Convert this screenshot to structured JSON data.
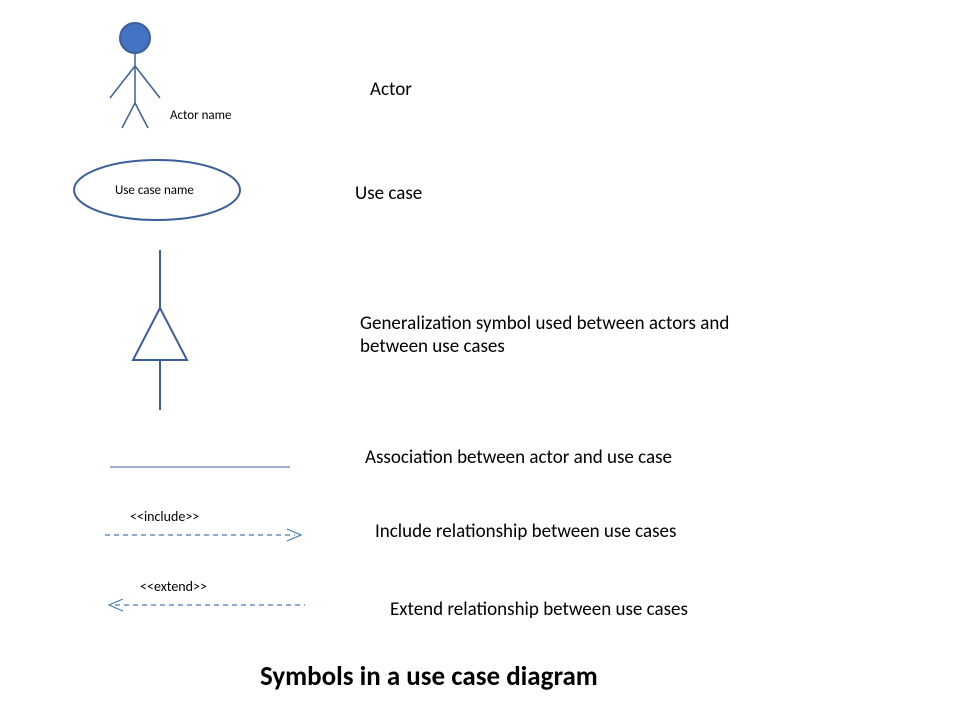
{
  "colors": {
    "shape_stroke": "#3a5f9a",
    "shape_fill_head": "#4472c4",
    "dashed_stroke": "#4a7bb5"
  },
  "rows": {
    "actor": {
      "symbol_label": "Actor name",
      "desc": "Actor"
    },
    "usecase": {
      "symbol_label": "Use case name",
      "desc": "Use case"
    },
    "generalization": {
      "desc": "Generalization symbol used between actors and between use cases"
    },
    "association": {
      "desc": "Association between actor and use case"
    },
    "include": {
      "stereotype": "<<include>>",
      "desc": "Include relationship between use cases"
    },
    "extend": {
      "stereotype": "<<extend>>",
      "desc": "Extend relationship between use cases"
    }
  },
  "title": "Symbols in a use case diagram"
}
